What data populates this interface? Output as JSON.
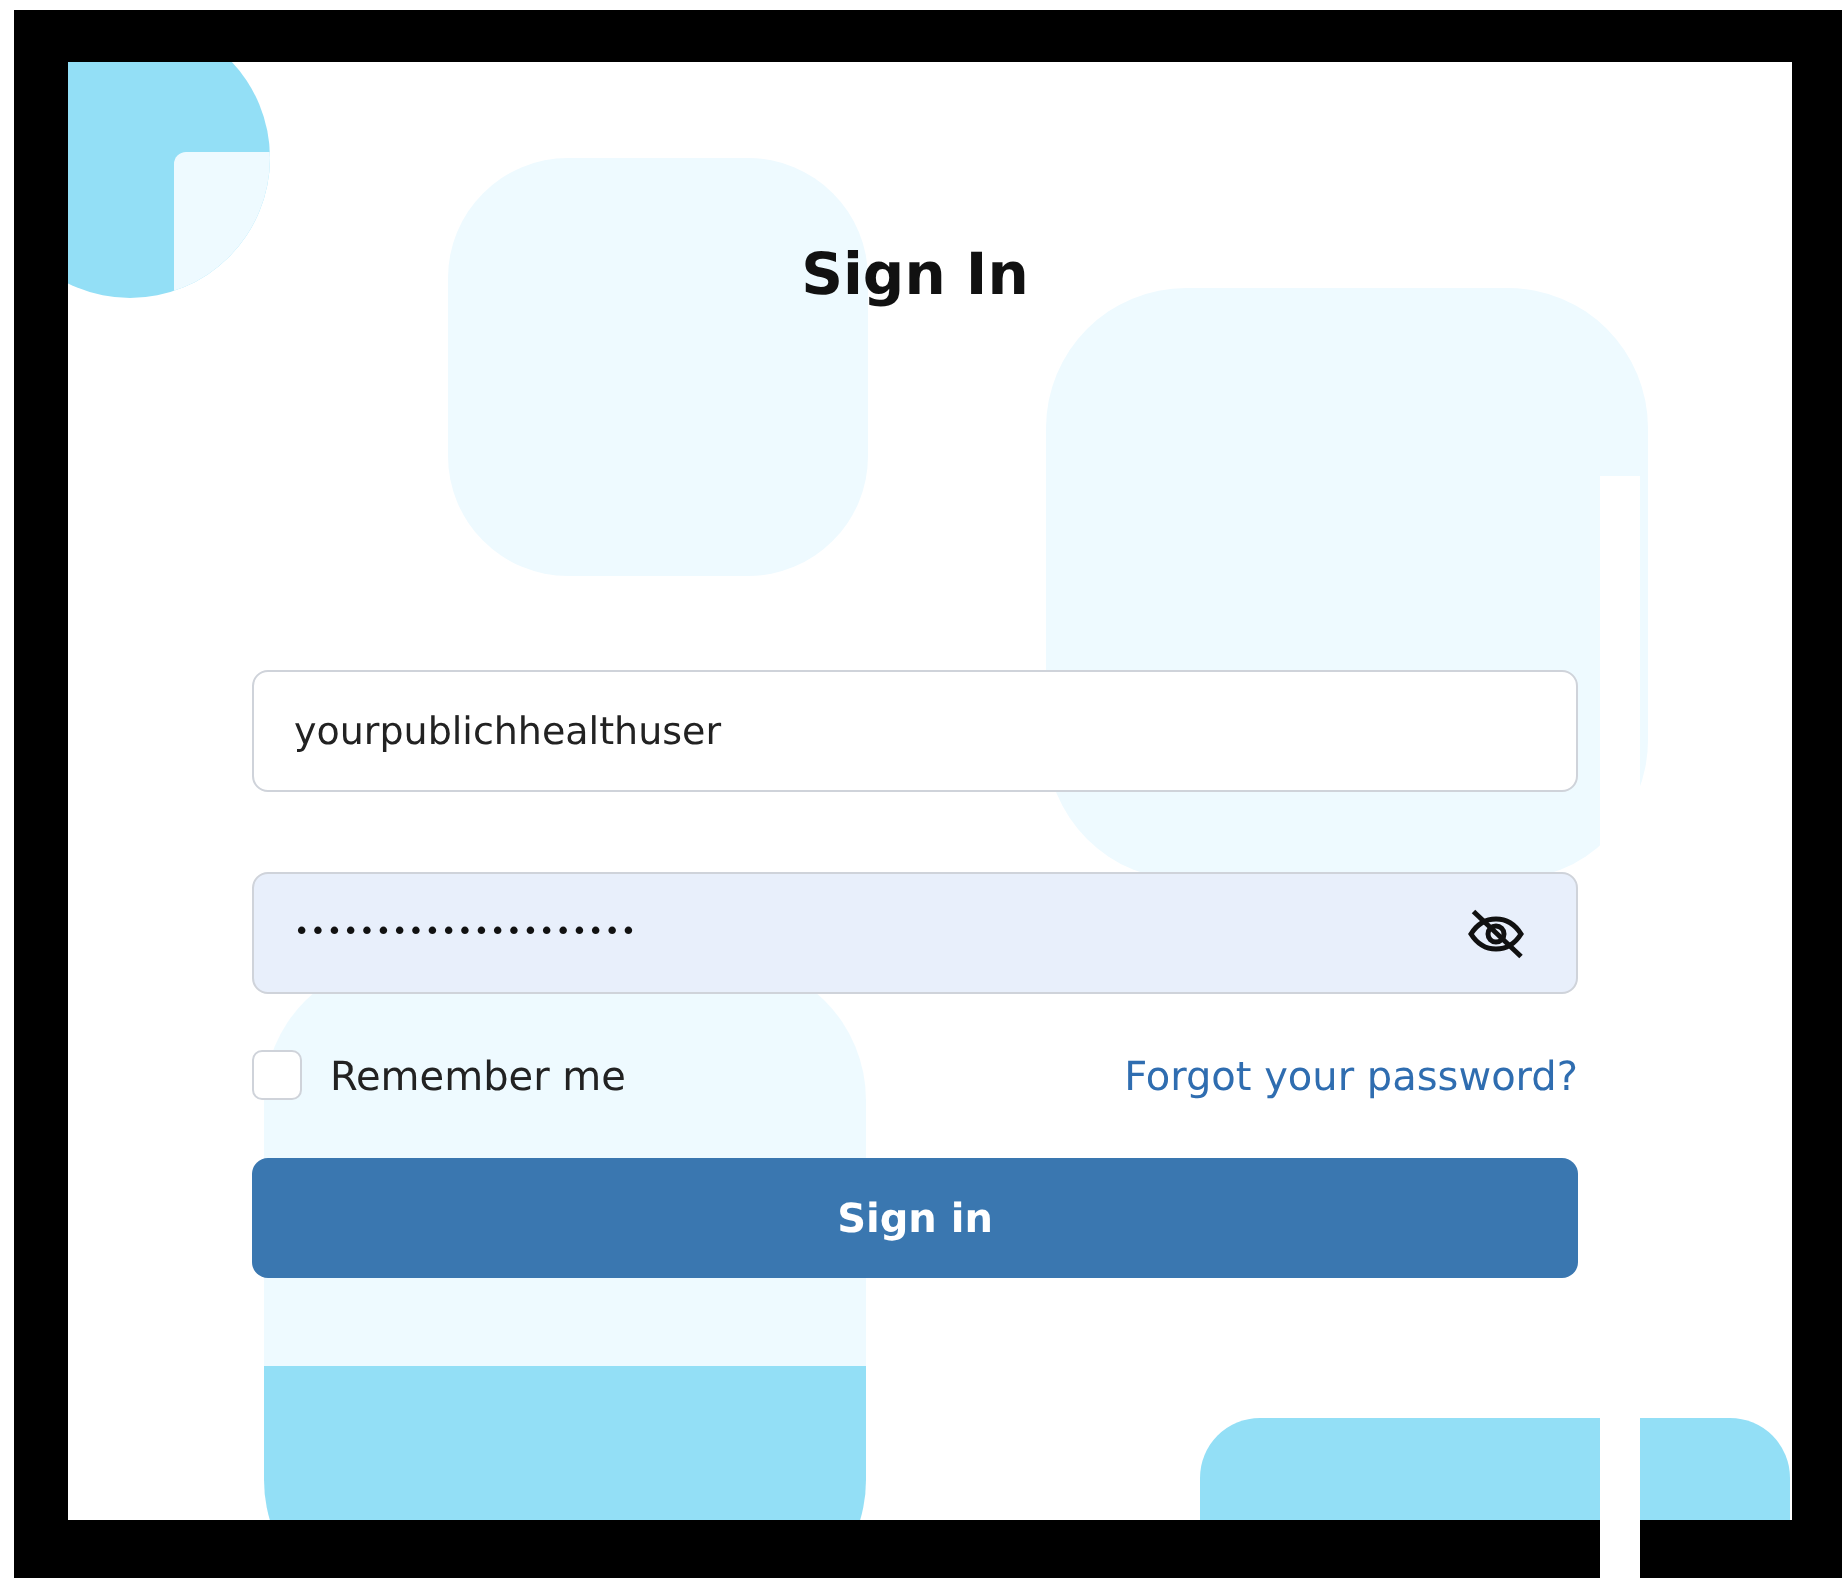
{
  "title": "Sign In",
  "username": {
    "value": "yourpublichhealthuser"
  },
  "password": {
    "value": "•••••••••••••••••••••"
  },
  "remember": {
    "label": "Remember me",
    "checked": false
  },
  "forgot_link": "Forgot your password?",
  "submit": "Sign in"
}
